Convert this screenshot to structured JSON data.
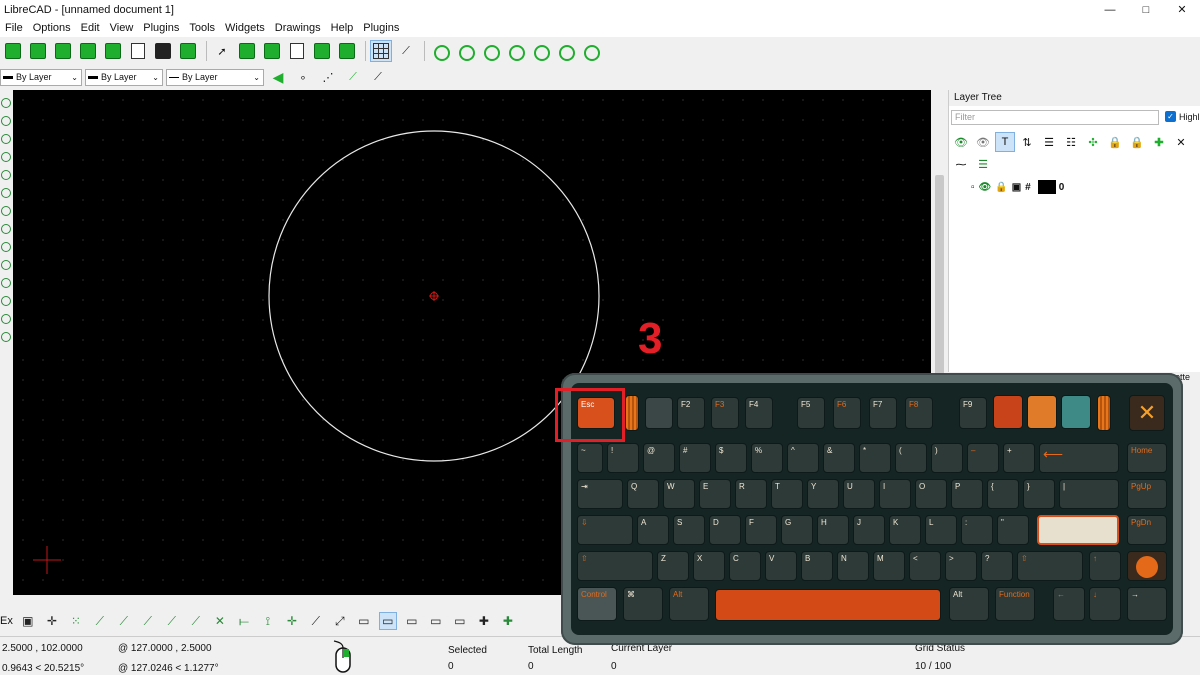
{
  "window": {
    "title": "LibreCAD - [unnamed document 1]",
    "controls": [
      "—",
      "□",
      "✕"
    ]
  },
  "menu": [
    "File",
    "Options",
    "Edit",
    "View",
    "Plugins",
    "Tools",
    "Widgets",
    "Drawings",
    "Help",
    "Plugins"
  ],
  "pen_toolbar": {
    "color": "By Layer",
    "width": "By Layer",
    "linetype": "By Layer"
  },
  "layer_tree": {
    "title": "Layer Tree",
    "filter_placeholder": "Filter",
    "highlight_label": "Highli",
    "highlight_checked": true,
    "layers": [
      {
        "name": "0",
        "color": "#000000"
      }
    ]
  },
  "palette_tab": "ette",
  "bottom_toolbar": {
    "label": "Ex"
  },
  "status": {
    "abs_coord": "2.5000 , 102.0000",
    "abs_polar": "0.9643 < 20.5215°",
    "rel_coord": "@  127.0000 , 2.5000",
    "rel_polar": "@  127.0246 < 1.1277°",
    "selected_label": "Selected",
    "selected_value": "0",
    "total_length_label": "Total Length",
    "total_length_value": "0",
    "current_layer_label": "Current Layer",
    "current_layer_value": "0",
    "grid_status_label": "Grid Status",
    "grid_status_value": "10 / 100"
  },
  "overlay": {
    "step_number": "3",
    "keyboard": {
      "esc": "Esc",
      "f_keys": [
        "F2",
        "F3",
        "F4",
        "F5",
        "F6",
        "F7",
        "F8",
        "F9"
      ],
      "num_row": [
        "~",
        "!",
        "@",
        "#",
        "$",
        "%",
        "^",
        "&",
        "*",
        "(",
        ")",
        "–",
        "+"
      ],
      "top_row": [
        "Q",
        "W",
        "E",
        "R",
        "T",
        "Y",
        "U",
        "I",
        "O",
        "P",
        "{",
        "}",
        "|"
      ],
      "home_row": [
        "A",
        "S",
        "D",
        "F",
        "G",
        "H",
        "J",
        "K",
        "L",
        ":",
        "\""
      ],
      "bottom_row": [
        "Z",
        "X",
        "C",
        "V",
        "B",
        "N",
        "M",
        "<",
        ">",
        "?"
      ],
      "right_col": [
        "Home",
        "PgUp",
        "PgDn"
      ],
      "mods": {
        "control": "Control",
        "cmd": "⌘",
        "alt": "Alt",
        "alt_r": "Alt",
        "function": "Function"
      }
    }
  }
}
